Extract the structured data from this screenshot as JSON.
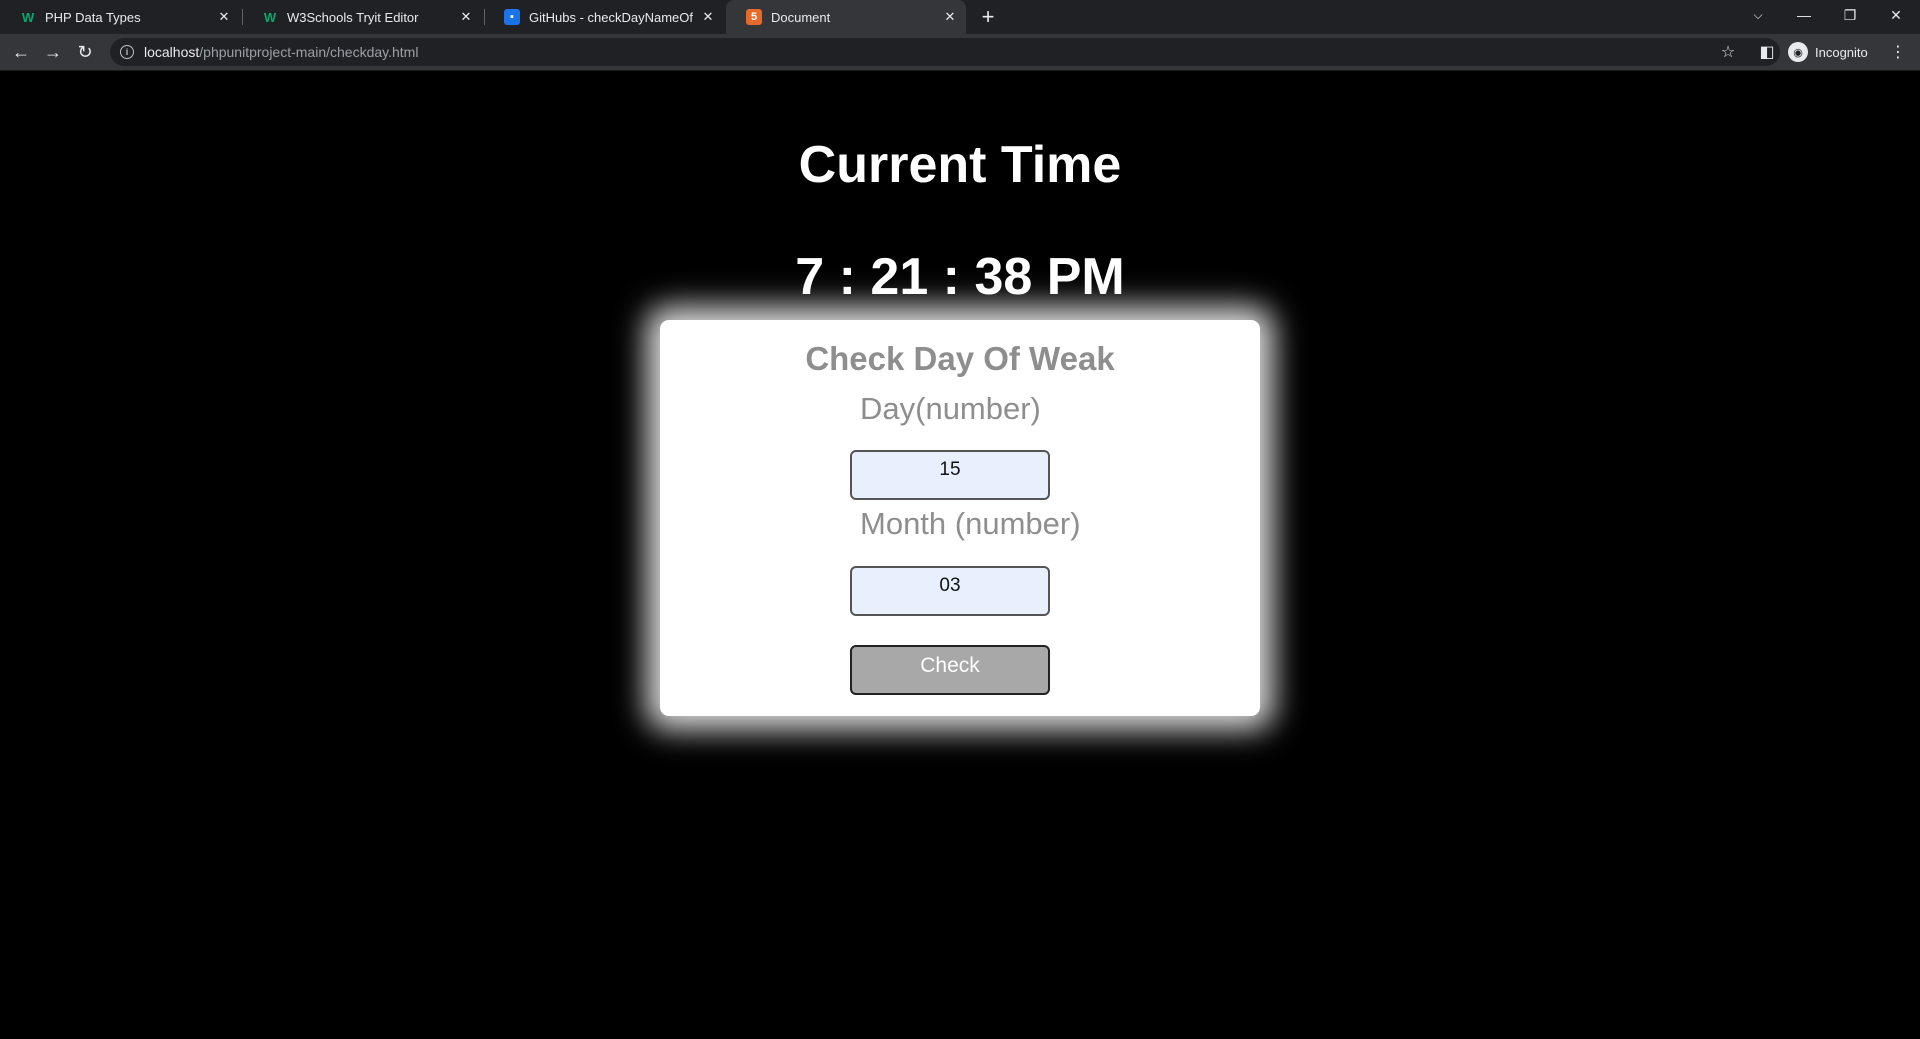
{
  "browser": {
    "tabs": [
      {
        "title": "PHP Data Types",
        "favicon": "w3schools-icon",
        "active": false
      },
      {
        "title": "W3Schools Tryit Editor",
        "favicon": "w3schools-icon",
        "active": false
      },
      {
        "title": "GitHubs - checkDayNameOfDate",
        "favicon": "github-pages-icon",
        "active": false
      },
      {
        "title": "Document",
        "favicon": "html-document-icon",
        "active": true
      }
    ],
    "address": {
      "host": "localhost",
      "path": "/phpunitproject-main/checkday.html"
    },
    "profile_label": "Incognito"
  },
  "page": {
    "clock_title": "Current Time",
    "clock_time": "7 : 21 : 38 PM",
    "form": {
      "title": "Check Day Of Weak",
      "day_label": "Day(number)",
      "day_value": "15",
      "month_label": "Month (number)",
      "month_value": "03",
      "button_label": "Check"
    }
  },
  "colors": {
    "page_background": "#000000",
    "card_background": "#ffffff",
    "label_gray": "#8e8e8e",
    "input_fill": "#e8f0fe",
    "button_fill": "#a8a8a8"
  }
}
